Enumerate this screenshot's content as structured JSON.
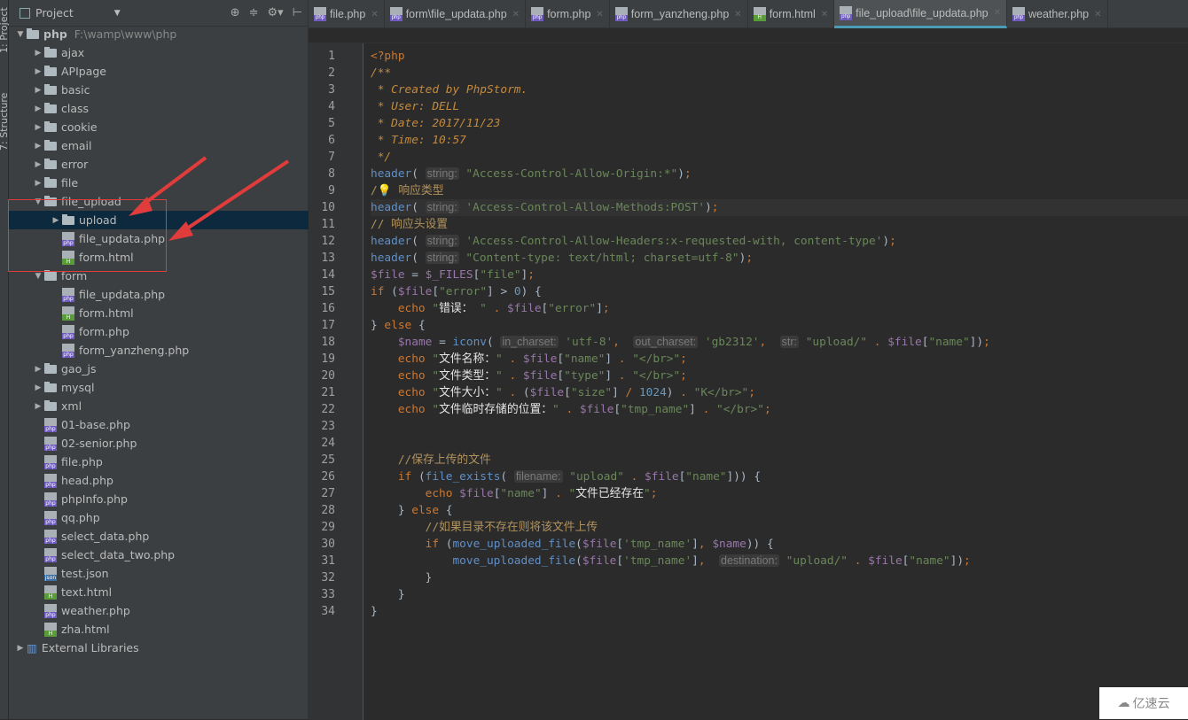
{
  "left_strip": {
    "project_tab": "1: Project",
    "structure_tab": "7: Structure"
  },
  "project_panel": {
    "title": "Project",
    "items": [
      {
        "label": "php",
        "path": "F:\\wamp\\www\\php",
        "type": "folder",
        "level": 0,
        "expanded": true,
        "bold": true
      },
      {
        "label": "ajax",
        "type": "folder",
        "level": 1
      },
      {
        "label": "APIpage",
        "type": "folder",
        "level": 1
      },
      {
        "label": "basic",
        "type": "folder",
        "level": 1
      },
      {
        "label": "class",
        "type": "folder",
        "level": 1
      },
      {
        "label": "cookie",
        "type": "folder",
        "level": 1
      },
      {
        "label": "email",
        "type": "folder",
        "level": 1
      },
      {
        "label": "error",
        "type": "folder",
        "level": 1
      },
      {
        "label": "file",
        "type": "folder",
        "level": 1
      },
      {
        "label": "file_upload",
        "type": "folder",
        "level": 1,
        "expanded": true
      },
      {
        "label": "upload",
        "type": "folder",
        "level": 2,
        "selected": true
      },
      {
        "label": "file_updata.php",
        "type": "php",
        "level": 2
      },
      {
        "label": "form.html",
        "type": "html",
        "level": 2
      },
      {
        "label": "form",
        "type": "folder",
        "level": 1,
        "expanded": true
      },
      {
        "label": "file_updata.php",
        "type": "php",
        "level": 2
      },
      {
        "label": "form.html",
        "type": "html",
        "level": 2
      },
      {
        "label": "form.php",
        "type": "php",
        "level": 2
      },
      {
        "label": "form_yanzheng.php",
        "type": "php",
        "level": 2
      },
      {
        "label": "gao_js",
        "type": "folder",
        "level": 1
      },
      {
        "label": "mysql",
        "type": "folder",
        "level": 1
      },
      {
        "label": "xml",
        "type": "folder",
        "level": 1
      },
      {
        "label": "01-base.php",
        "type": "php",
        "level": 1
      },
      {
        "label": "02-senior.php",
        "type": "php",
        "level": 1
      },
      {
        "label": "file.php",
        "type": "php",
        "level": 1
      },
      {
        "label": "head.php",
        "type": "php",
        "level": 1
      },
      {
        "label": "phpInfo.php",
        "type": "php",
        "level": 1
      },
      {
        "label": "qq.php",
        "type": "php",
        "level": 1
      },
      {
        "label": "select_data.php",
        "type": "php",
        "level": 1
      },
      {
        "label": "select_data_two.php",
        "type": "php",
        "level": 1
      },
      {
        "label": "test.json",
        "type": "json",
        "level": 1
      },
      {
        "label": "text.html",
        "type": "html",
        "level": 1
      },
      {
        "label": "weather.php",
        "type": "php",
        "level": 1
      },
      {
        "label": "zha.html",
        "type": "html",
        "level": 1
      },
      {
        "label": "External Libraries",
        "type": "lib",
        "level": 0
      }
    ]
  },
  "tabs": [
    {
      "label": "file.php",
      "type": "php"
    },
    {
      "label": "form\\file_updata.php",
      "type": "php"
    },
    {
      "label": "form.php",
      "type": "php"
    },
    {
      "label": "form_yanzheng.php",
      "type": "php"
    },
    {
      "label": "form.html",
      "type": "html"
    },
    {
      "label": "file_upload\\file_updata.php",
      "type": "php",
      "active": true
    },
    {
      "label": "weather.php",
      "type": "php"
    }
  ],
  "colors": {
    "accent": "#4a9bb6",
    "annotation": "#e03c3c",
    "keyword": "#cc7832",
    "string": "#6a8759",
    "variable": "#9876aa"
  },
  "code": [
    [
      [
        "kw",
        "<?php"
      ]
    ],
    [
      [
        "doc",
        "/**"
      ]
    ],
    [
      [
        "doc",
        " * Created by PhpStorm."
      ]
    ],
    [
      [
        "doc",
        " * User: DELL"
      ]
    ],
    [
      [
        "doc",
        " * Date: 2017/11/23"
      ]
    ],
    [
      [
        "doc",
        " * Time: 10:57"
      ]
    ],
    [
      [
        "doc",
        " */"
      ]
    ],
    [
      [
        "fn",
        "header"
      ],
      [
        "",
        "( "
      ],
      [
        "hint",
        "string:"
      ],
      [
        "str",
        " \"Access-Control-Allow-Origin:*\""
      ],
      [
        "",
        ")"
      ],
      [
        "kw",
        ";"
      ]
    ],
    [
      [
        "cm",
        "/💡 响应类型"
      ]
    ],
    [
      [
        "fn",
        "header"
      ],
      [
        "",
        "( "
      ],
      [
        "hint",
        "string:"
      ],
      [
        "str",
        " 'Access-Control-Allow-Methods:POST'"
      ],
      [
        "",
        ")"
      ],
      [
        "kw",
        ";"
      ]
    ],
    [
      [
        "cm",
        "// 响应头设置"
      ]
    ],
    [
      [
        "fn",
        "header"
      ],
      [
        "",
        "( "
      ],
      [
        "hint",
        "string:"
      ],
      [
        "str",
        " 'Access-Control-Allow-Headers:x-requested-with, content-type'"
      ],
      [
        "",
        ")"
      ],
      [
        "kw",
        ";"
      ]
    ],
    [
      [
        "fn",
        "header"
      ],
      [
        "",
        "( "
      ],
      [
        "hint",
        "string:"
      ],
      [
        "str",
        " \"Content-type: text/html; charset=utf-8\""
      ],
      [
        "",
        ")"
      ],
      [
        "kw",
        ";"
      ]
    ],
    [
      [
        "var",
        "$file"
      ],
      [
        "",
        " = "
      ],
      [
        "var",
        "$_FILES"
      ],
      [
        "",
        "["
      ],
      [
        "str",
        "\"file\""
      ],
      [
        "",
        "]"
      ],
      [
        "kw",
        ";"
      ]
    ],
    [
      [
        "kw",
        "if"
      ],
      [
        "",
        " ("
      ],
      [
        "var",
        "$file"
      ],
      [
        "",
        "["
      ],
      [
        "str",
        "\"error\""
      ],
      [
        "",
        "] > "
      ],
      [
        "num",
        "0"
      ],
      [
        "",
        ") {"
      ]
    ],
    [
      [
        "",
        ""
      ],
      [
        "kw",
        "    echo "
      ],
      [
        "str",
        "\""
      ],
      [
        "cn",
        "错误："
      ],
      [
        "str",
        " \""
      ],
      [
        "kw",
        " . "
      ],
      [
        "var",
        "$file"
      ],
      [
        "",
        "["
      ],
      [
        "str",
        "\"error\""
      ],
      [
        "",
        "]"
      ],
      [
        "kw",
        ";"
      ]
    ],
    [
      [
        "",
        "} "
      ],
      [
        "kw",
        "else"
      ],
      [
        "",
        " {"
      ]
    ],
    [
      [
        "",
        "    "
      ],
      [
        "var",
        "$name"
      ],
      [
        "",
        " = "
      ],
      [
        "fn",
        "iconv"
      ],
      [
        "",
        "( "
      ],
      [
        "hint",
        "in_charset:"
      ],
      [
        "str",
        " 'utf-8'"
      ],
      [
        "kw",
        ", "
      ],
      [
        "",
        " "
      ],
      [
        "hint",
        "out_charset:"
      ],
      [
        "str",
        " 'gb2312'"
      ],
      [
        "kw",
        ", "
      ],
      [
        "",
        " "
      ],
      [
        "hint",
        "str:"
      ],
      [
        "str",
        " \"upload/\""
      ],
      [
        "kw",
        " . "
      ],
      [
        "var",
        "$file"
      ],
      [
        "",
        "["
      ],
      [
        "str",
        "\"name\""
      ],
      [
        "",
        "])"
      ],
      [
        "kw",
        ";"
      ]
    ],
    [
      [
        "kw",
        "    echo "
      ],
      [
        "str",
        "\""
      ],
      [
        "cn",
        "文件名称："
      ],
      [
        "str",
        "\""
      ],
      [
        "kw",
        " . "
      ],
      [
        "var",
        "$file"
      ],
      [
        "",
        "["
      ],
      [
        "str",
        "\"name\""
      ],
      [
        "",
        "]"
      ],
      [
        "kw",
        " . "
      ],
      [
        "str",
        "\"</br>\""
      ],
      [
        "kw",
        ";"
      ]
    ],
    [
      [
        "kw",
        "    echo "
      ],
      [
        "str",
        "\""
      ],
      [
        "cn",
        "文件类型："
      ],
      [
        "str",
        "\""
      ],
      [
        "kw",
        " . "
      ],
      [
        "var",
        "$file"
      ],
      [
        "",
        "["
      ],
      [
        "str",
        "\"type\""
      ],
      [
        "",
        "]"
      ],
      [
        "kw",
        " . "
      ],
      [
        "str",
        "\"</br>\""
      ],
      [
        "kw",
        ";"
      ]
    ],
    [
      [
        "kw",
        "    echo "
      ],
      [
        "str",
        "\""
      ],
      [
        "cn",
        "文件大小："
      ],
      [
        "str",
        "\""
      ],
      [
        "kw",
        " . "
      ],
      [
        "",
        "("
      ],
      [
        "var",
        "$file"
      ],
      [
        "",
        "["
      ],
      [
        "str",
        "\"size\""
      ],
      [
        "",
        "] "
      ],
      [
        "kw",
        "/"
      ],
      [
        "",
        " "
      ],
      [
        "num",
        "1024"
      ],
      [
        "",
        ")"
      ],
      [
        "kw",
        " . "
      ],
      [
        "str",
        "\"K</br>\""
      ],
      [
        "kw",
        ";"
      ]
    ],
    [
      [
        "kw",
        "    echo "
      ],
      [
        "str",
        "\""
      ],
      [
        "cn",
        "文件临时存储的位置："
      ],
      [
        "str",
        "\""
      ],
      [
        "kw",
        " . "
      ],
      [
        "var",
        "$file"
      ],
      [
        "",
        "["
      ],
      [
        "str",
        "\"tmp_name\""
      ],
      [
        "",
        "]"
      ],
      [
        "kw",
        " . "
      ],
      [
        "str",
        "\"</br>\""
      ],
      [
        "kw",
        ";"
      ]
    ],
    [],
    [],
    [
      [
        "cm",
        "    //保存上传的文件"
      ]
    ],
    [
      [
        "kw",
        "    if"
      ],
      [
        "",
        " ("
      ],
      [
        "fn",
        "file_exists"
      ],
      [
        "",
        "( "
      ],
      [
        "hint",
        "filename:"
      ],
      [
        "str",
        " \"upload\""
      ],
      [
        "kw",
        " . "
      ],
      [
        "var",
        "$file"
      ],
      [
        "",
        "["
      ],
      [
        "str",
        "\"name\""
      ],
      [
        "",
        "])) {"
      ]
    ],
    [
      [
        "kw",
        "        echo "
      ],
      [
        "var",
        "$file"
      ],
      [
        "",
        "["
      ],
      [
        "str",
        "\"name\""
      ],
      [
        "",
        "]"
      ],
      [
        "kw",
        " . "
      ],
      [
        "str",
        "\""
      ],
      [
        "cn",
        "文件已经存在"
      ],
      [
        "str",
        "\""
      ],
      [
        "kw",
        ";"
      ]
    ],
    [
      [
        "",
        "    } "
      ],
      [
        "kw",
        "else"
      ],
      [
        "",
        " {"
      ]
    ],
    [
      [
        "cm",
        "        //如果目录不存在则将该文件上传"
      ]
    ],
    [
      [
        "kw",
        "        if"
      ],
      [
        "",
        " ("
      ],
      [
        "fn",
        "move_uploaded_file"
      ],
      [
        "",
        "("
      ],
      [
        "var",
        "$file"
      ],
      [
        "",
        "["
      ],
      [
        "str",
        "'tmp_name'"
      ],
      [
        "",
        "]"
      ],
      [
        "kw",
        ", "
      ],
      [
        "var",
        "$name"
      ],
      [
        "",
        ")) {"
      ]
    ],
    [
      [
        "",
        "            "
      ],
      [
        "fn",
        "move_uploaded_file"
      ],
      [
        "",
        "("
      ],
      [
        "var",
        "$file"
      ],
      [
        "",
        "["
      ],
      [
        "str",
        "'tmp_name'"
      ],
      [
        "",
        "]"
      ],
      [
        "kw",
        ", "
      ],
      [
        "",
        " "
      ],
      [
        "hint",
        "destination:"
      ],
      [
        "str",
        " \"upload/\""
      ],
      [
        "kw",
        " . "
      ],
      [
        "var",
        "$file"
      ],
      [
        "",
        "["
      ],
      [
        "str",
        "\"name\""
      ],
      [
        "",
        "])"
      ],
      [
        "kw",
        ";"
      ]
    ],
    [
      [
        "",
        "        }"
      ]
    ],
    [
      [
        "",
        "    }"
      ]
    ],
    [
      [
        "",
        "}"
      ]
    ]
  ],
  "watermark": "亿速云"
}
